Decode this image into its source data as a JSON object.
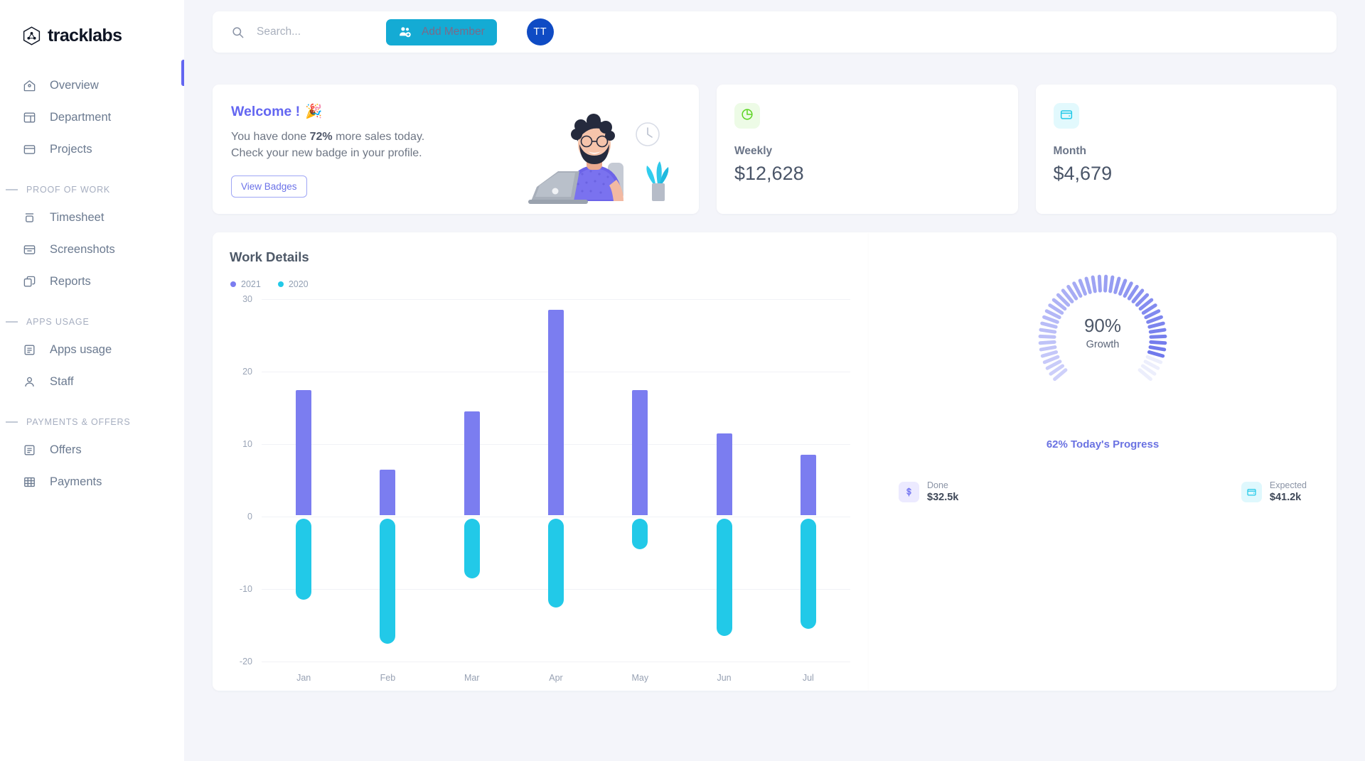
{
  "brand": {
    "name": "tracklabs",
    "logo_icon": "hexagon-network-icon"
  },
  "sidebar": {
    "items_top": [
      {
        "label": "Overview",
        "icon": "home-icon",
        "active": true
      },
      {
        "label": "Department",
        "icon": "layout-panel-icon",
        "active": false
      },
      {
        "label": "Projects",
        "icon": "window-icon",
        "active": false
      }
    ],
    "section_1": "PROOF OF WORK",
    "items_proof": [
      {
        "label": "Timesheet",
        "icon": "timesheet-icon"
      },
      {
        "label": "Screenshots",
        "icon": "screenshot-icon"
      },
      {
        "label": "Reports",
        "icon": "copy-reports-icon"
      }
    ],
    "section_2": "APPS USAGE",
    "items_apps": [
      {
        "label": "Apps usage",
        "icon": "list-document-icon"
      },
      {
        "label": "Staff",
        "icon": "user-icon"
      }
    ],
    "section_3": "PAYMENTS & OFFERS",
    "items_payments": [
      {
        "label": "Offers",
        "icon": "offer-document-icon"
      },
      {
        "label": "Payments",
        "icon": "grid-table-icon"
      }
    ]
  },
  "topbar": {
    "search_placeholder": "Search...",
    "search_value": "",
    "search_icon": "search-icon",
    "add_member_label": "Add Member",
    "add_member_icon": "add-people-icon",
    "avatar_initials": "TT"
  },
  "welcome": {
    "title": "Welcome !",
    "emoji": "🎉",
    "line1_pre": "You have done ",
    "line1_bold": "72%",
    "line1_post": " more sales today.",
    "line2": "Check your new badge in your profile.",
    "button_label": "View Badges"
  },
  "stats": [
    {
      "label": "Weekly",
      "value": "$12,628",
      "icon": "pie-chart-icon",
      "icon_color": "#5ed424",
      "icon_bg": "#edfbe6"
    },
    {
      "label": "Month",
      "value": "$4,679",
      "icon": "wallet-icon",
      "icon_color": "#22c9e8",
      "icon_bg": "#e2f9fd"
    }
  ],
  "chart_data": {
    "type": "bar",
    "title": "Work Details",
    "categories": [
      "Jan",
      "Feb",
      "Mar",
      "Apr",
      "May",
      "Jun",
      "Jul"
    ],
    "series": [
      {
        "name": "2021",
        "color": "#7b7df0",
        "values": [
          17.5,
          6.5,
          14.5,
          28.5,
          17.5,
          11.5,
          8.5
        ]
      },
      {
        "name": "2020",
        "color": "#22c9e8",
        "values": [
          -11.5,
          -17.5,
          -8.5,
          -12.5,
          -4.5,
          -16.5,
          -15.5
        ]
      }
    ],
    "yticks": [
      30,
      20,
      10,
      0,
      -10,
      -20
    ],
    "ylim": [
      -20,
      30
    ],
    "xlabel": "",
    "ylabel": "",
    "grid": true,
    "legend_position": "top-left"
  },
  "growth": {
    "percent_label": "90%",
    "sub_label": "Growth",
    "gauge_value": 90,
    "today_progress": "62% Today's Progress",
    "mini_stats": [
      {
        "label": "Done",
        "value": "$32.5k",
        "icon": "dollar-icon",
        "icon_color": "#6c6ff0",
        "icon_bg": "#eceaff"
      },
      {
        "label": "Expected",
        "value": "$41.2k",
        "icon": "wallet-icon",
        "icon_color": "#22c9e8",
        "icon_bg": "#dff8fd"
      }
    ]
  },
  "colors": {
    "accent_purple": "#6366f1",
    "accent_teal": "#14abd4",
    "bar_purple": "#7b7df0",
    "bar_cyan": "#22c9e8",
    "page_bg": "#f4f5fa"
  }
}
